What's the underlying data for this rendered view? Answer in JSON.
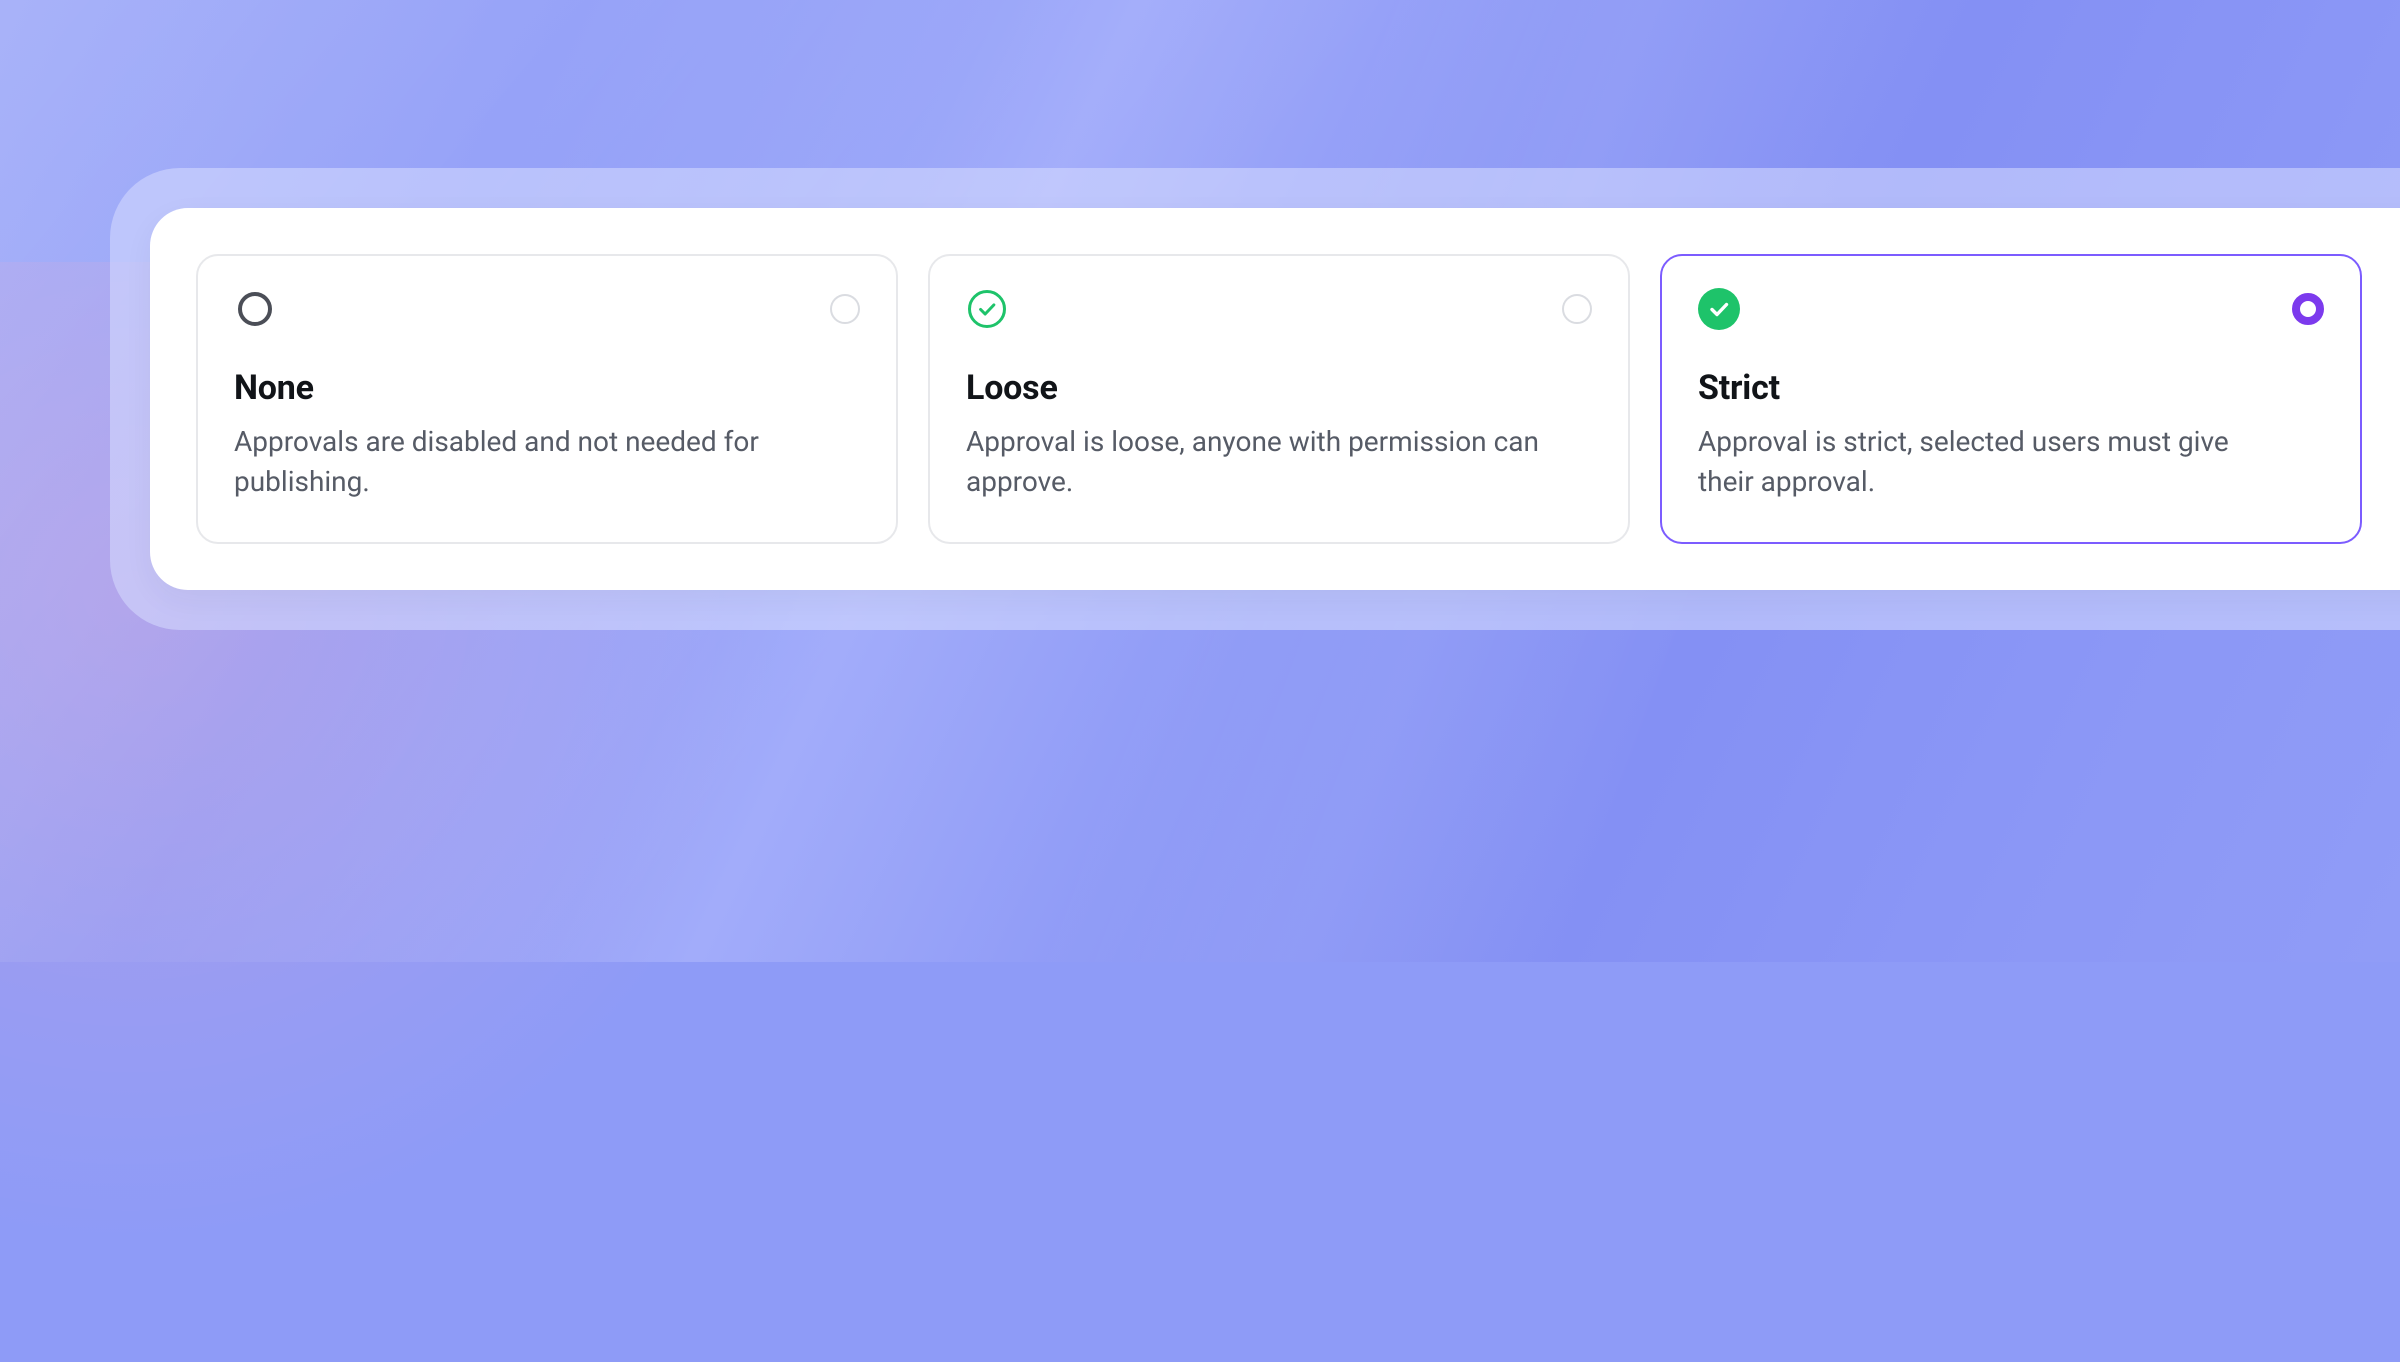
{
  "colors": {
    "accent": "#7C3AED",
    "success": "#1EC36A",
    "border": "#E7E8EB",
    "text": "#111418",
    "muted": "#565B66"
  },
  "options": [
    {
      "id": "none",
      "title": "None",
      "description": "Approvals are disabled and not needed for publishing.",
      "selected": false,
      "lead_icon": "circle-outline"
    },
    {
      "id": "loose",
      "title": "Loose",
      "description": "Approval is loose, anyone with permission can approve.",
      "selected": false,
      "lead_icon": "check-outline"
    },
    {
      "id": "strict",
      "title": "Strict",
      "description": "Approval is strict, selected users must give their approval.",
      "selected": true,
      "lead_icon": "check-solid"
    }
  ]
}
